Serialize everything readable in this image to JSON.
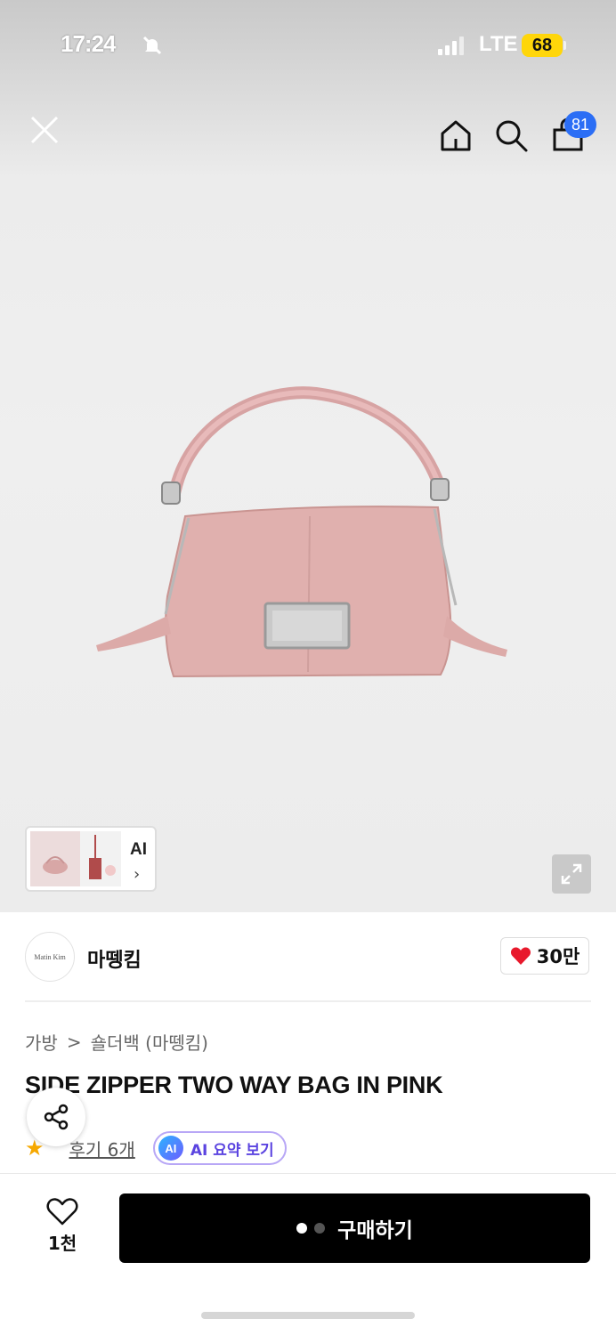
{
  "status_bar": {
    "time": "17:24",
    "network": "LTE",
    "battery": "68"
  },
  "nav": {
    "cart_count": "81"
  },
  "gallery": {
    "ai_label": "AI",
    "ai_chevron": "›"
  },
  "brand": {
    "name": "마뗑킴",
    "logo_text": "Matin Kim",
    "likes": "30만"
  },
  "breadcrumb": {
    "category": "가방",
    "separator": ">",
    "subcategory": "숄더백 (마뗑킴)"
  },
  "product": {
    "title": "SIDE ZIPPER TWO WAY BAG IN PINK"
  },
  "reviews": {
    "link": "후기 6개",
    "ai_badge": "AI",
    "ai_summary": "AI 요약 보기"
  },
  "bottom_bar": {
    "wishlist_count": "1천",
    "buy_label": "구매하기"
  },
  "icons": [
    "close-icon",
    "home-icon",
    "search-icon",
    "cart-icon",
    "expand-icon",
    "heart-icon",
    "share-icon",
    "star-icon",
    "bell-off-icon"
  ],
  "colors": {
    "accent_blue": "#2b6ef5",
    "heart_red": "#e8192c",
    "buy_button": "#000000",
    "ai_purple": "#5b44e0",
    "star": "#f6a800",
    "battery": "#ffd60a"
  }
}
